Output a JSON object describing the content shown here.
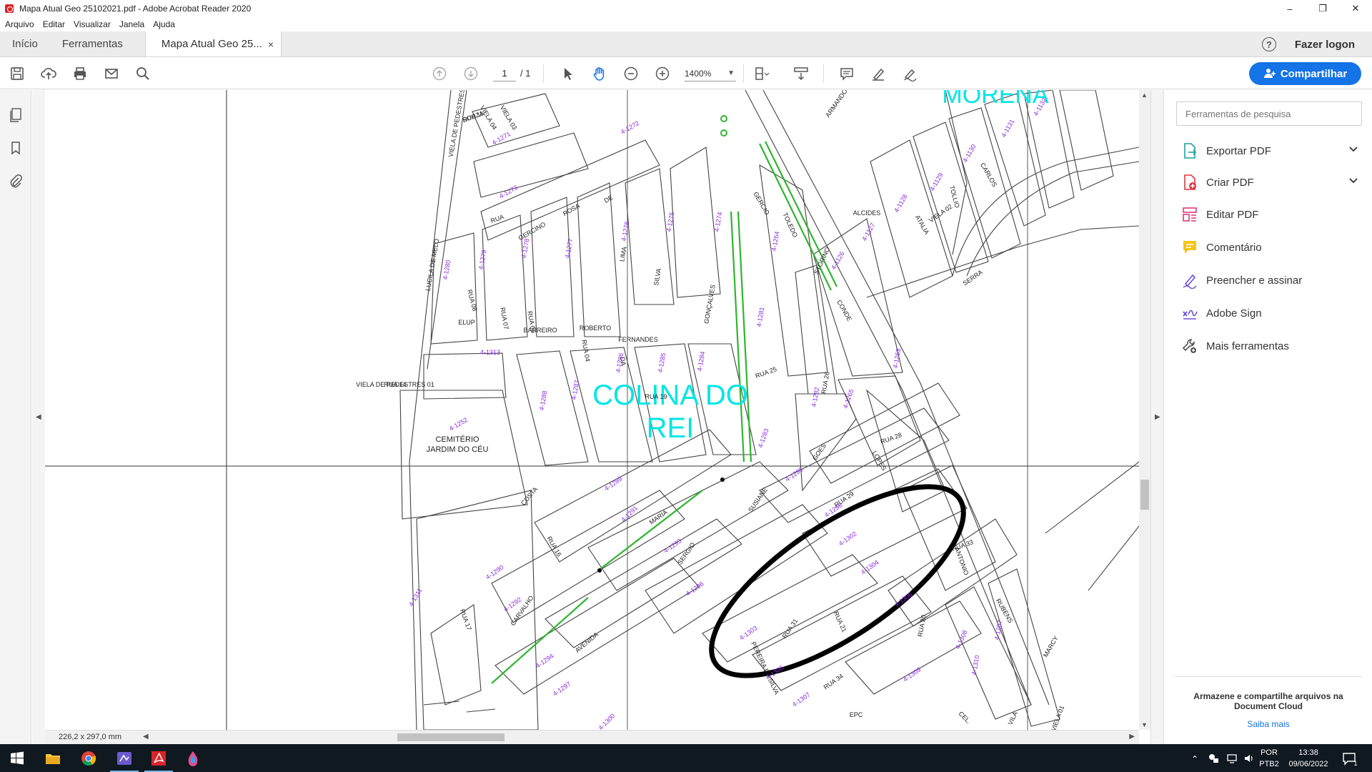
{
  "window": {
    "title": "Mapa Atual Geo 25102021.pdf - Adobe Acrobat Reader 2020",
    "controls": [
      "–",
      "❐",
      "✕"
    ]
  },
  "menu": [
    "Arquivo",
    "Editar",
    "Visualizar",
    "Janela",
    "Ajuda"
  ],
  "tabs": {
    "home": "Início",
    "tools": "Ferramentas",
    "doc": "Mapa Atual Geo 25...",
    "close": "×",
    "help": "?",
    "login": "Fazer logon"
  },
  "toolbar": {
    "page_current": "1",
    "page_total": "/ 1",
    "zoom": "1400%",
    "share_label": "Compartilhar"
  },
  "map": {
    "district_main": [
      "COLINA DO",
      "REI"
    ],
    "district_top": "MORENA",
    "cemetery": [
      "CEMITÉRIO",
      "JARDIM DO CÉU"
    ],
    "elup": "ELUP",
    "epc": "EPC",
    "streets": [
      "RUA 11",
      "RUA 14",
      "RUA 19",
      "RUA 25",
      "RUA 26",
      "RUA 28",
      "RUA 29",
      "RUA 31",
      "RUA 33",
      "RUA 34",
      "RUA 08",
      "RUA 07",
      "RUA 06",
      "RUA 04",
      "RUA 16",
      "RUA 17",
      "RUA 20",
      "RUA 21",
      "RUA",
      "GERCINO",
      "ROSA",
      "DE",
      "LIMA",
      "SILVA",
      "GONÇALVES",
      "BARREIRO",
      "ROBERTO",
      "FERNANDES",
      "DA",
      "COSTA",
      "MARIA",
      "SERGIO",
      "CARVALHO",
      "AVENIDA",
      "SUSIANE",
      "GOES",
      "LOPES",
      "ANTONIO",
      "RUBENS",
      "TOLEDO",
      "STORINO",
      "ARMANDO",
      "MARCY",
      "CEL.",
      "VILA",
      "VIELA 01",
      "VIELA 02",
      "VIELA 03",
      "VIELA 04",
      "VIELA DE PEDESTRES 02",
      "LUCILA DE MELO",
      "PEREIRA DA SILVA",
      "CONDE",
      "GERCIO",
      "ALCIDES",
      "ATALIA",
      "TOLLIO",
      "CARLOS",
      "SERRA",
      "SOUZA",
      "VIELA DE PEDESTRES 01"
    ],
    "lots": [
      "4-1271",
      "4-1272",
      "4-1273",
      "4-1274",
      "4-1275",
      "4-1276",
      "4-1277",
      "4-1278",
      "4-1279",
      "4-1280",
      "4-1281",
      "4-1282",
      "4-1283",
      "4-1284",
      "4-1285",
      "4-1286",
      "4-1287",
      "4-1288",
      "4-1289",
      "4-1290",
      "4-1291",
      "4-1292",
      "4-1293",
      "4-1294",
      "4-1295",
      "4-1296",
      "4-1297",
      "4-1298",
      "4-1300",
      "4-1302",
      "4-1303",
      "4-1304",
      "4-1305",
      "4-1306",
      "4-1307",
      "4-1308",
      "4-1309",
      "4-1310",
      "4-1311",
      "4-1313",
      "4-1252",
      "4-1263",
      "4-1264",
      "4-1265",
      "4-1267",
      "4-1126",
      "4-1127",
      "4-1128",
      "4-1129",
      "4-1130",
      "4-1131",
      "4-1132"
    ]
  },
  "status": {
    "page_size": "226,2 x 297,0 mm"
  },
  "right_panel": {
    "search_placeholder": "Ferramentas de pesquisa",
    "tools": [
      "Exportar PDF",
      "Criar PDF",
      "Editar PDF",
      "Comentário",
      "Preencher e assinar",
      "Adobe Sign",
      "Mais ferramentas"
    ],
    "cloud_message": "Armazene e compartilhe arquivos na Document Cloud",
    "cloud_link": "Saiba mais"
  },
  "taskbar": {
    "lang1": "POR",
    "lang2": "PTB2",
    "time": "13:38",
    "date": "09/06/2022",
    "notif_count": "1"
  },
  "colors": {
    "accent": "#1473e6",
    "map_lot_label": "#8a2be2",
    "map_district": "#00e5e5",
    "map_green": "#2fb52f",
    "taskbar": "#101820"
  }
}
